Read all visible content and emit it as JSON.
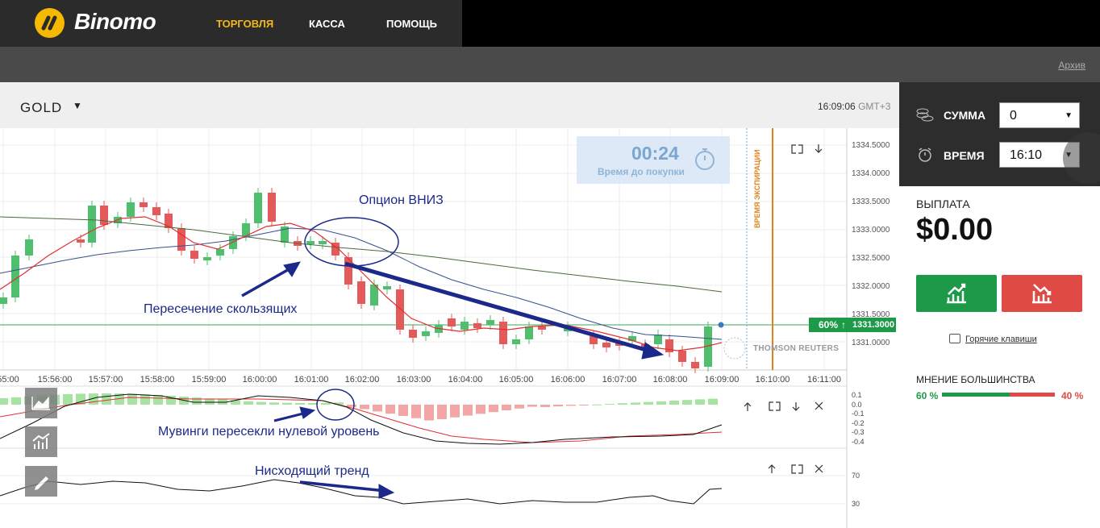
{
  "brand": {
    "name": "Binomo",
    "accent": "#f4b81c"
  },
  "nav": {
    "trade": "ТОРГОВЛЯ",
    "cashier": "КАССА",
    "help": "ПОМОЩЬ"
  },
  "subbar": {
    "archive": "Архив"
  },
  "asset": {
    "name": "GOLD",
    "time": "16:09:06",
    "timezone": "GMT+3"
  },
  "timer": {
    "value": "00:24",
    "label": "Время до покупки"
  },
  "expiry_label": "ВРЕМЯ ЭКСПИРАЦИИ",
  "price_badge": {
    "pct": "60%",
    "arrow": "↑",
    "price": "1331.3000"
  },
  "watermark": "THOMSON REUTERS",
  "chart_data": {
    "type": "candlestick",
    "price_ticks": [
      "1334.5000",
      "1334.0000",
      "1333.5000",
      "1333.0000",
      "1332.5000",
      "1332.0000",
      "1331.5000",
      "1331.0000"
    ],
    "time_ticks": [
      "55:00",
      "15:56:00",
      "15:57:00",
      "15:58:00",
      "15:59:00",
      "16:00:00",
      "16:01:00",
      "16:02:00",
      "16:03:00",
      "16:04:00",
      "16:05:00",
      "16:06:00",
      "16:07:00",
      "16:08:00",
      "16:09:00",
      "16:10:00",
      "16:11:00"
    ],
    "macd_ticks": [
      "0.1",
      "0.0",
      "-0.1",
      "-0.2",
      "-0.3",
      "-0.4"
    ],
    "rsi_ticks": [
      "70",
      "30"
    ],
    "current_price": 1331.3,
    "colors": {
      "up": "#4fbf6e",
      "down": "#e45a5a",
      "fast_ma": "#e03030",
      "mid_ma": "#3a4f8c",
      "slow_ma": "#4a6a3a"
    }
  },
  "annotations": {
    "option_down": "Опцион ВНИЗ",
    "ma_cross": "Пересечение скользящих",
    "zero_cross": "Мувинги пересекли нулевой уровень",
    "downtrend": "Нисходящий тренд"
  },
  "sidebar": {
    "amount_label": "СУММА",
    "amount_value": "0",
    "time_label": "ВРЕМЯ",
    "time_value": "16:10",
    "payout_label": "ВЫПЛАТА",
    "payout_value": "$0.00",
    "hotkeys": "Горячие клавиши",
    "majority_label": "МНЕНИЕ БОЛЬШИНСТВА",
    "majority_up": "60 %",
    "majority_down": "40 %",
    "majority_up_fraction": 0.6
  }
}
